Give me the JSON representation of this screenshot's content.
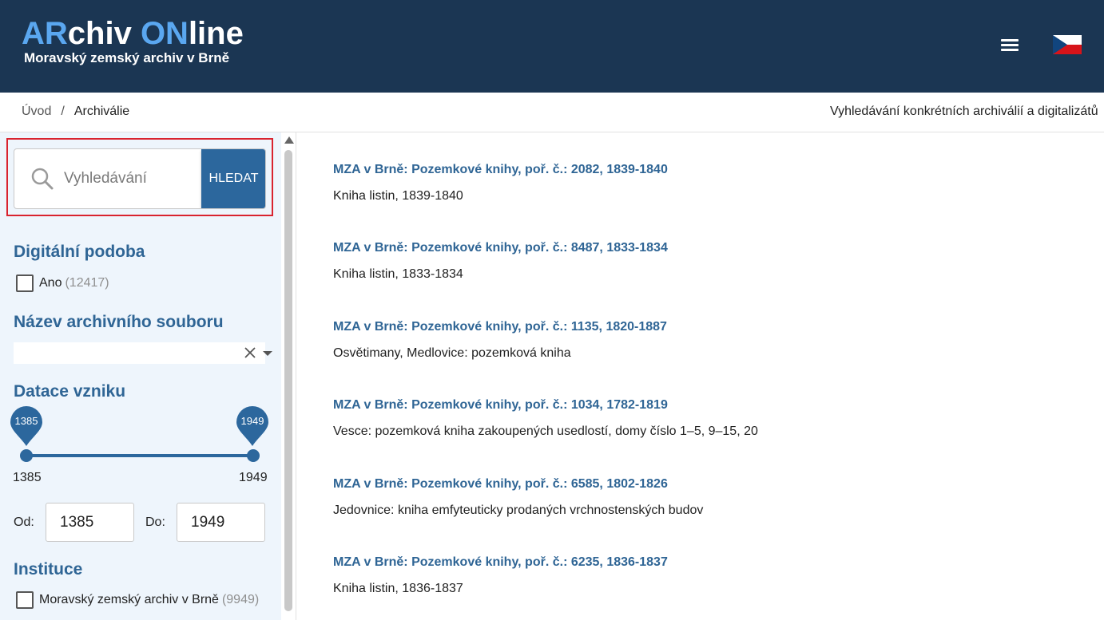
{
  "header": {
    "logo_ar": "AR",
    "logo_chiv": "chiv ",
    "logo_on": "ON",
    "logo_line": "line",
    "logo_subtitle": "Moravský zemský archiv v Brně",
    "menu_icon": "hamburger-menu-icon",
    "language_icon": "czech-flag-icon"
  },
  "breadcrumb": {
    "home": "Úvod",
    "separator": "/",
    "current": "Archiválie",
    "right_text": "Vyhledávání konkrétních archiválií a digitalizátů"
  },
  "sidebar": {
    "search": {
      "placeholder": "Vyhledávání",
      "value": "",
      "button_label": "HLEDAT"
    },
    "digital": {
      "title": "Digitální podoba",
      "option_label": "Ano",
      "option_count": "(12417)"
    },
    "fonds": {
      "title": "Název archivního souboru",
      "selected": ""
    },
    "dating": {
      "title": "Datace vzniku",
      "slider_min": "1385",
      "slider_max": "1949",
      "from_label": "Od:",
      "from_value": "1385",
      "to_label": "Do:",
      "to_value": "1949"
    },
    "institution": {
      "title": "Instituce",
      "option_label": "Moravský zemský archiv v Brně",
      "option_count": "(9949)"
    }
  },
  "results": [
    {
      "title": "MZA v Brně: Pozemkové knihy, poř. č.: 2082, 1839-1840",
      "desc": "Kniha listin, 1839-1840"
    },
    {
      "title": "MZA v Brně: Pozemkové knihy, poř. č.: 8487, 1833-1834",
      "desc": "Kniha listin, 1833-1834"
    },
    {
      "title": "MZA v Brně: Pozemkové knihy, poř. č.: 1135, 1820-1887",
      "desc": "Osvětimany, Medlovice: pozemková kniha"
    },
    {
      "title": "MZA v Brně: Pozemkové knihy, poř. č.: 1034, 1782-1819",
      "desc": "Vesce: pozemková kniha zakoupených usedlostí, domy číslo 1–5, 9–15, 20"
    },
    {
      "title": "MZA v Brně: Pozemkové knihy, poř. č.: 6585, 1802-1826",
      "desc": "Jedovnice: kniha emfyteuticky prodaných vrchnostenských budov"
    },
    {
      "title": "MZA v Brně: Pozemkové knihy, poř. č.: 6235, 1836-1837",
      "desc": "Kniha listin, 1836-1837"
    }
  ],
  "colors": {
    "header_bg": "#1b3653",
    "logo_accent": "#5aa7f0",
    "primary": "#2c679d",
    "link": "#2f6595",
    "sidebar_bg": "#eef5fc",
    "highlight_outline": "#d9232e"
  }
}
